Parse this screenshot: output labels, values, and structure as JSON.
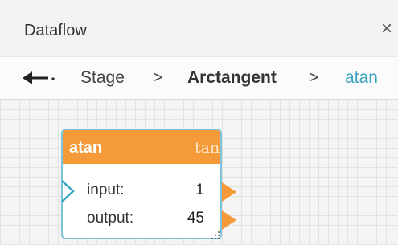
{
  "window": {
    "title": "Dataflow",
    "close_glyph": "×"
  },
  "breadcrumb": {
    "back_icon": "back-arrow-icon",
    "items": [
      "Stage",
      "Arctangent",
      "atan"
    ],
    "separator": ">"
  },
  "node": {
    "title": "atan",
    "function_symbol": "tan",
    "header_color": "#f59a38",
    "border_color": "#7ec3d8",
    "ports": [
      {
        "label": "input:",
        "value": "1"
      },
      {
        "label": "output:",
        "value": "45"
      }
    ]
  },
  "colors": {
    "link": "#3aa3c0",
    "port": "#f59a38",
    "input_port": "#3aa3c0"
  }
}
